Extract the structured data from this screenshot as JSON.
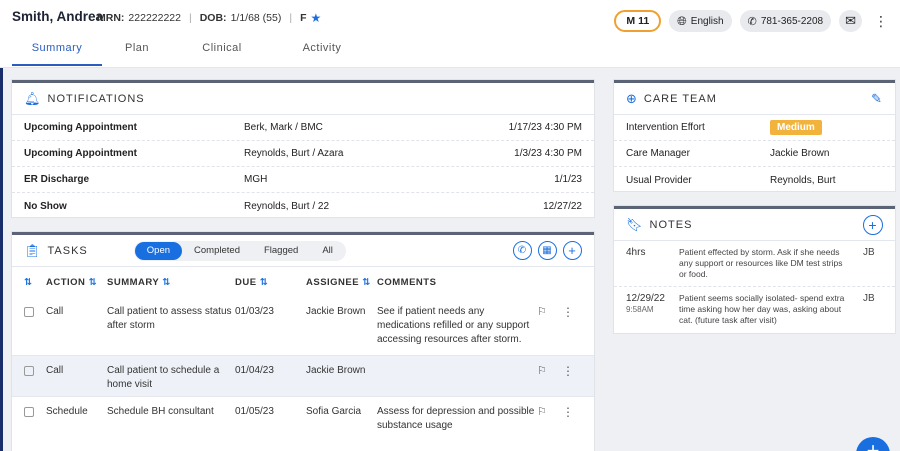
{
  "patient": {
    "name": "Smith, Andrea",
    "mrn_label": "MRN:",
    "mrn": "222222222",
    "dob_label": "DOB:",
    "dob": "1/1/68 (55)",
    "sex": "F"
  },
  "header": {
    "member_code": "M 11",
    "language": "English",
    "phone": "781-365-2208"
  },
  "tabs": [
    "Summary",
    "Plan",
    "Clinical",
    "Activity"
  ],
  "notifications": {
    "title": "NOTIFICATIONS",
    "rows": [
      {
        "type": "Upcoming Appointment",
        "who": "Berk, Mark / BMC",
        "when": "1/17/23 4:30 PM"
      },
      {
        "type": "Upcoming Appointment",
        "who": "Reynolds, Burt / Azara",
        "when": "1/3/23 4:30 PM"
      },
      {
        "type": "ER Discharge",
        "who": "MGH",
        "when": "1/1/23"
      },
      {
        "type": "No Show",
        "who": "Reynolds, Burt / 22",
        "when": "12/27/22"
      }
    ]
  },
  "care_team": {
    "title": "CARE TEAM",
    "rows": [
      {
        "label": "Intervention Effort",
        "value": "Medium"
      },
      {
        "label": "Care Manager",
        "value": "Jackie Brown"
      },
      {
        "label": "Usual Provider",
        "value": "Reynolds, Burt"
      }
    ]
  },
  "notes": {
    "title": "NOTES",
    "items": [
      {
        "date": "4hrs",
        "time": "",
        "text": "Patient effected by storm. Ask if she needs any support or resources like DM test strips or food.",
        "author": "JB"
      },
      {
        "date": "12/29/22",
        "time": "9:58AM",
        "text": "Patient seems socially isolated- spend extra time asking how her day was, asking about cat. (future task after visit)",
        "author": "JB"
      }
    ]
  },
  "tasks": {
    "title": "TASKS",
    "filters": [
      "Open",
      "Completed",
      "Flagged",
      "All"
    ],
    "columns": {
      "action": "ACTION",
      "summary": "SUMMARY",
      "due": "DUE",
      "assignee": "ASSIGNEE",
      "comments": "COMMENTS"
    },
    "rows": [
      {
        "action": "Call",
        "summary": "Call patient to assess status after storm",
        "due": "01/03/23",
        "assignee": "Jackie Brown",
        "comments": "See if patient needs any medications refilled or any support accessing resources after storm."
      },
      {
        "action": "Call",
        "summary": "Call patient to schedule a home visit",
        "due": "01/04/23",
        "assignee": "Jackie Brown",
        "comments": ""
      },
      {
        "action": "Schedule",
        "summary": "Schedule BH consultant",
        "due": "01/05/23",
        "assignee": "Sofia Garcia",
        "comments": "Assess for depression and possible substance usage"
      }
    ]
  },
  "colors": {
    "accent": "#1a6fe0",
    "badge": "#f2b33d",
    "m11_border": "#f0a030"
  }
}
